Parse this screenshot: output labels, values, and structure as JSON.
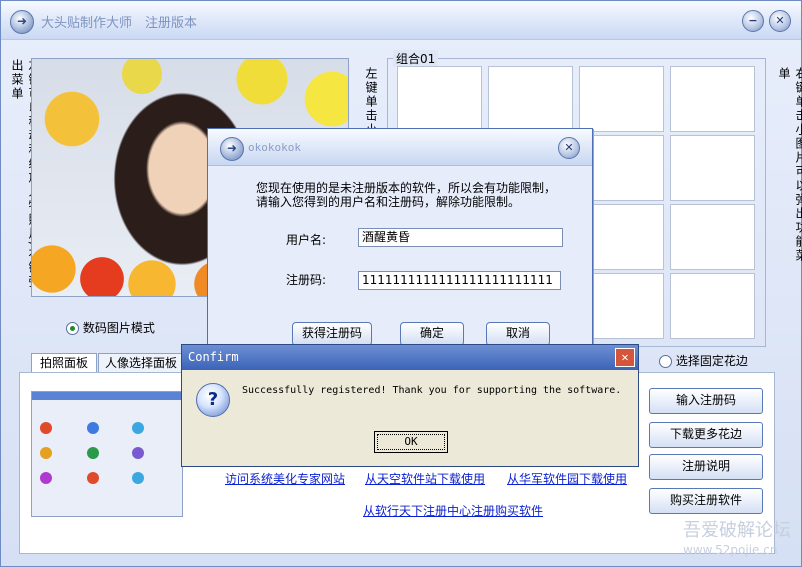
{
  "window": {
    "title": "大头贴制作大师　注册版本"
  },
  "left_hint": "左键可以移动和缩放人物照片,右键弹出菜单",
  "middle_hint": "左键单击小",
  "right_hint": "右键单击小图片可以弹出功能菜单",
  "group": {
    "label": "组合01"
  },
  "mode_radio": {
    "label": "数码图片模式",
    "selected": true
  },
  "fixed_border_radio": {
    "label": "选择固定花边",
    "selected": false
  },
  "tabs": [
    "拍照面板",
    "人像选择面板"
  ],
  "links": [
    "访问系统美化专家网站",
    "从天空软件站下载使用",
    "从华军软件园下载使用",
    "从软行天下注册中心注册购买软件"
  ],
  "right_buttons": [
    "输入注册码",
    "下载更多花边",
    "注册说明",
    "购买注册软件"
  ],
  "reg_dialog": {
    "title": "okokokok",
    "message_line1": "您现在使用的是未注册版本的软件，所以会有功能限制，",
    "message_line2": "请输入您得到的用户名和注册码，解除功能限制。",
    "username_label": "用户名:",
    "username_value": "酒醒黄昏",
    "code_label": "注册码:",
    "code_value": "1111111111111111111111111",
    "buttons": [
      "获得注册码",
      "确定",
      "取消"
    ]
  },
  "confirm": {
    "title": "Confirm",
    "message": "Successfully registered! Thank you for supporting the software.",
    "ok": "OK"
  },
  "watermark": {
    "line1": "吾爱破解论坛",
    "line2": "www.52pojie.cn"
  }
}
